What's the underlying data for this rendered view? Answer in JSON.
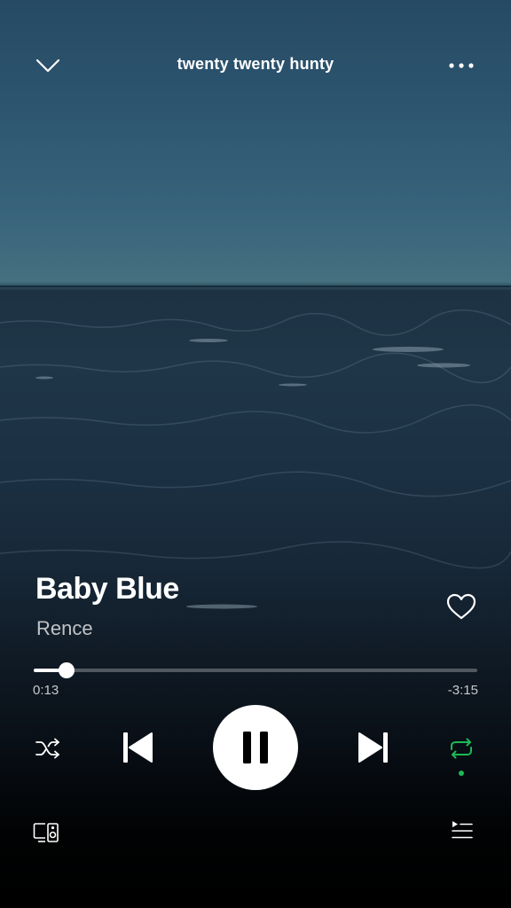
{
  "header": {
    "playlist_title": "twenty twenty hunty",
    "collapse_icon": "chevron-down-icon",
    "more_icon": "more-dots-icon"
  },
  "track": {
    "title": "Baby Blue",
    "artist": "Rence",
    "liked": false
  },
  "progress": {
    "elapsed": "0:13",
    "remaining": "-3:15",
    "fraction": 0.074
  },
  "controls": {
    "shuffle_icon": "shuffle-icon",
    "previous_icon": "skip-previous-icon",
    "play_pause_icon": "pause-icon",
    "next_icon": "skip-next-icon",
    "repeat_icon": "repeat-icon",
    "repeat_active": true
  },
  "bottom": {
    "devices_icon": "devices-icon",
    "queue_icon": "queue-icon"
  },
  "colors": {
    "accent": "#1db954",
    "text_secondary": "#bfc3c6",
    "sky": "#3a6580",
    "sea": "#1b3043"
  }
}
